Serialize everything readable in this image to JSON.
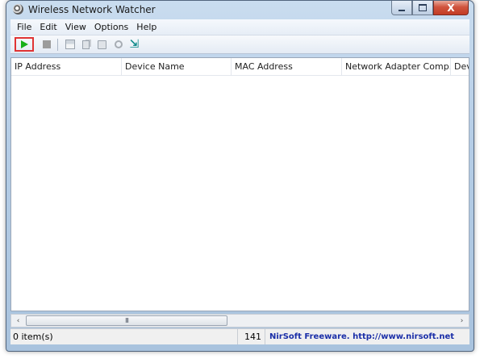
{
  "window": {
    "title": "Wireless Network Watcher",
    "close_symbol": "X"
  },
  "menu": [
    "File",
    "Edit",
    "View",
    "Options",
    "Help"
  ],
  "toolbar": {
    "buttons": [
      {
        "name": "start-scan",
        "icon": "play-icon",
        "color": "#18b018",
        "highlight": "#e03434"
      },
      {
        "name": "stop-scan",
        "icon": "stop-icon"
      },
      {
        "name": "save",
        "icon": "save-icon"
      },
      {
        "name": "copy",
        "icon": "copy-icon"
      },
      {
        "name": "properties",
        "icon": "properties-icon"
      },
      {
        "name": "refresh",
        "icon": "refresh-icon"
      },
      {
        "name": "exit",
        "icon": "exit-icon"
      }
    ]
  },
  "list": {
    "columns": [
      "IP Address",
      "Device Name",
      "MAC Address",
      "Network Adapter Comp...",
      "Dev"
    ],
    "rows": []
  },
  "scrollbar": {
    "left_arrow": "‹",
    "right_arrow": "›",
    "grip": "III"
  },
  "status": {
    "items": "0 item(s)",
    "count": "141",
    "credit": "NirSoft Freeware.  http://www.nirsoft.net"
  }
}
